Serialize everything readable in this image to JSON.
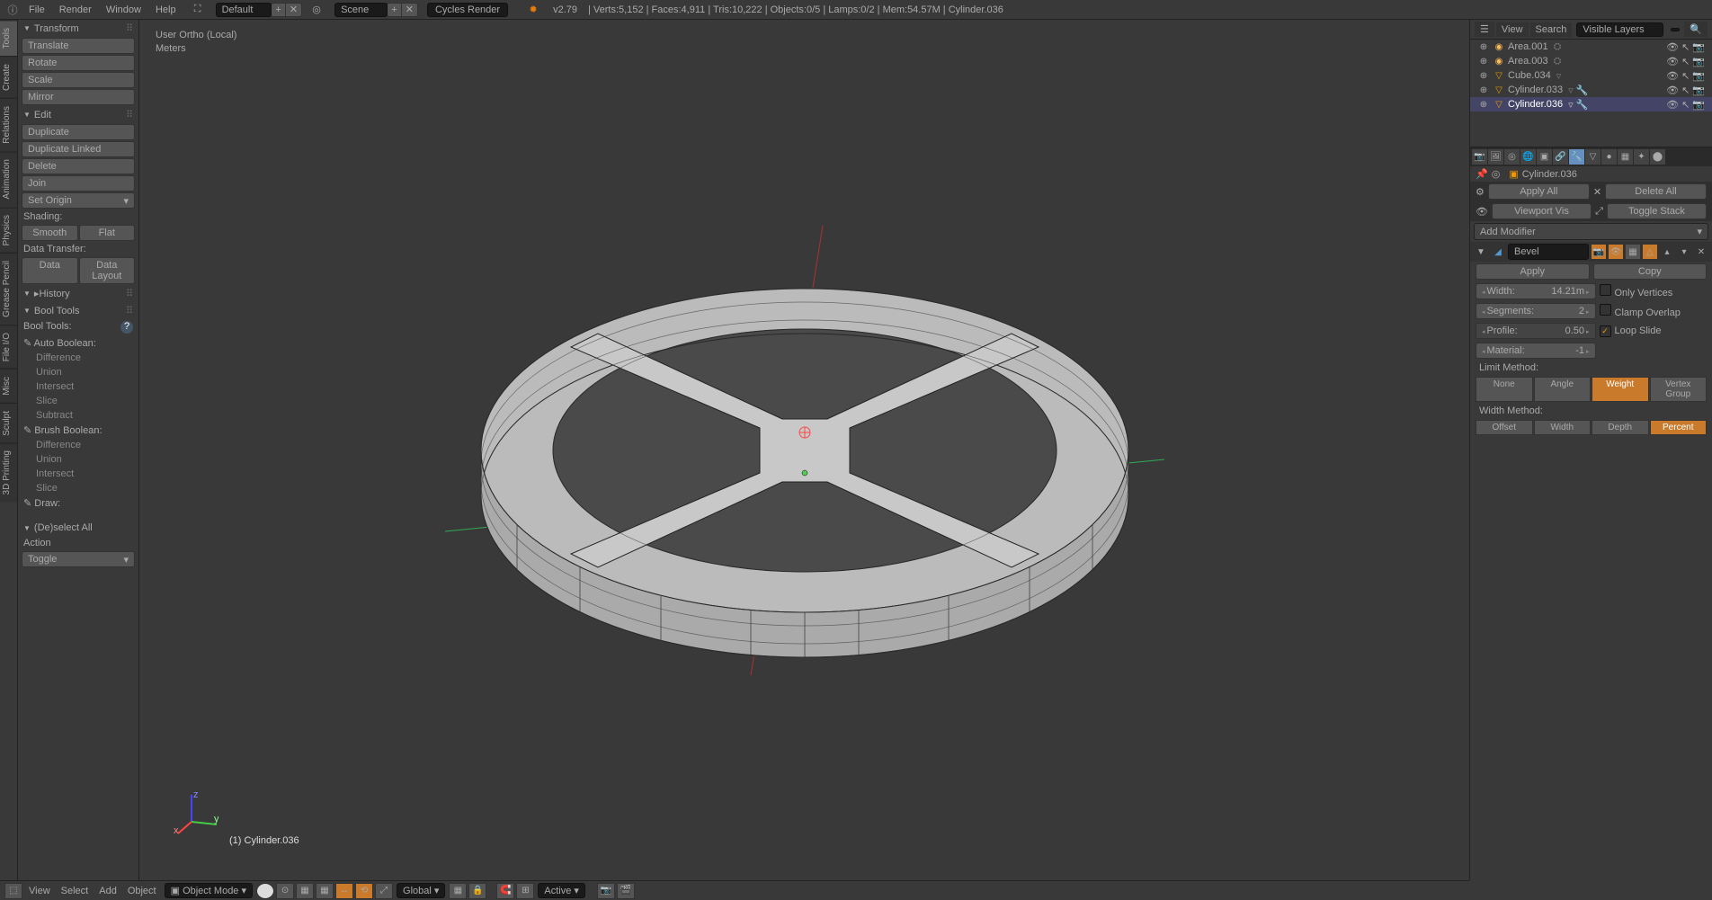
{
  "topbar": {
    "menus": [
      "File",
      "Render",
      "Window",
      "Help"
    ],
    "layout": "Default",
    "scene": "Scene",
    "renderer": "Cycles Render",
    "version": "v2.79",
    "stats": "Verts:5,152 | Faces:4,911 | Tris:10,222 | Objects:0/5 | Lamps:0/2 | Mem:54.57M | Cylinder.036"
  },
  "left_tabs": [
    "Create",
    "Relations",
    "Animation",
    "Physics",
    "Grease Pencil",
    "File I/O",
    "Misc",
    "Sculpt",
    "3D Printing"
  ],
  "tools": {
    "transform": {
      "title": "Transform",
      "items": [
        "Translate",
        "Rotate",
        "Scale",
        "Mirror"
      ]
    },
    "edit": {
      "title": "Edit",
      "duplicate": "Duplicate",
      "duplicate_linked": "Duplicate Linked",
      "delete": "Delete",
      "join": "Join",
      "set_origin": "Set Origin",
      "shading": "Shading:",
      "smooth": "Smooth",
      "flat": "Flat",
      "data_transfer": "Data Transfer:",
      "data": "Data",
      "data_layout": "Data Layout"
    },
    "history": {
      "title": "History"
    },
    "bool": {
      "title": "Bool Tools",
      "label": "Bool Tools:",
      "auto": "Auto Boolean:",
      "items": [
        "Difference",
        "Union",
        "Intersect",
        "Slice",
        "Subtract"
      ],
      "brush": "Brush Boolean:",
      "bitems": [
        "Difference",
        "Union",
        "Intersect",
        "Slice"
      ],
      "draw": "Draw:"
    },
    "deselect": {
      "title": "(De)select All",
      "action": "Action",
      "toggle": "Toggle"
    }
  },
  "viewport": {
    "info1": "User Ortho (Local)",
    "info2": "Meters",
    "selection": "(1) Cylinder.036"
  },
  "outliner_hdr": {
    "view": "View",
    "search": "Search",
    "visible": "Visible Layers"
  },
  "outliner": [
    {
      "name": "Area.001",
      "type": "lamp",
      "sel": false
    },
    {
      "name": "Area.003",
      "type": "lamp",
      "sel": false
    },
    {
      "name": "Cube.034",
      "type": "mesh",
      "sel": false
    },
    {
      "name": "Cylinder.033",
      "type": "mesh",
      "sel": false,
      "mod": true
    },
    {
      "name": "Cylinder.036",
      "type": "mesh",
      "sel": true,
      "mod": true
    }
  ],
  "props": {
    "object": "Cylinder.036",
    "apply_all": "Apply All",
    "delete_all": "Delete All",
    "viewport_vis": "Viewport Vis",
    "toggle_stack": "Toggle Stack",
    "add_modifier": "Add Modifier",
    "mod_name": "Bevel",
    "apply": "Apply",
    "copy": "Copy",
    "width_l": "Width:",
    "width_v": "14.21m",
    "segments_l": "Segments:",
    "segments_v": "2",
    "profile_l": "Profile:",
    "profile_v": "0.50",
    "material_l": "Material:",
    "material_v": "-1",
    "only_vertices": "Only Vertices",
    "clamp_overlap": "Clamp Overlap",
    "loop_slide": "Loop Slide",
    "limit_method": "Limit Method:",
    "lm": [
      "None",
      "Angle",
      "Weight",
      "Vertex Group"
    ],
    "width_method": "Width Method:",
    "wm": [
      "Offset",
      "Width",
      "Depth",
      "Percent"
    ]
  },
  "bottom": {
    "menus": [
      "View",
      "Select",
      "Add",
      "Object"
    ],
    "mode": "Object Mode",
    "orient": "Global",
    "active": "Active"
  }
}
